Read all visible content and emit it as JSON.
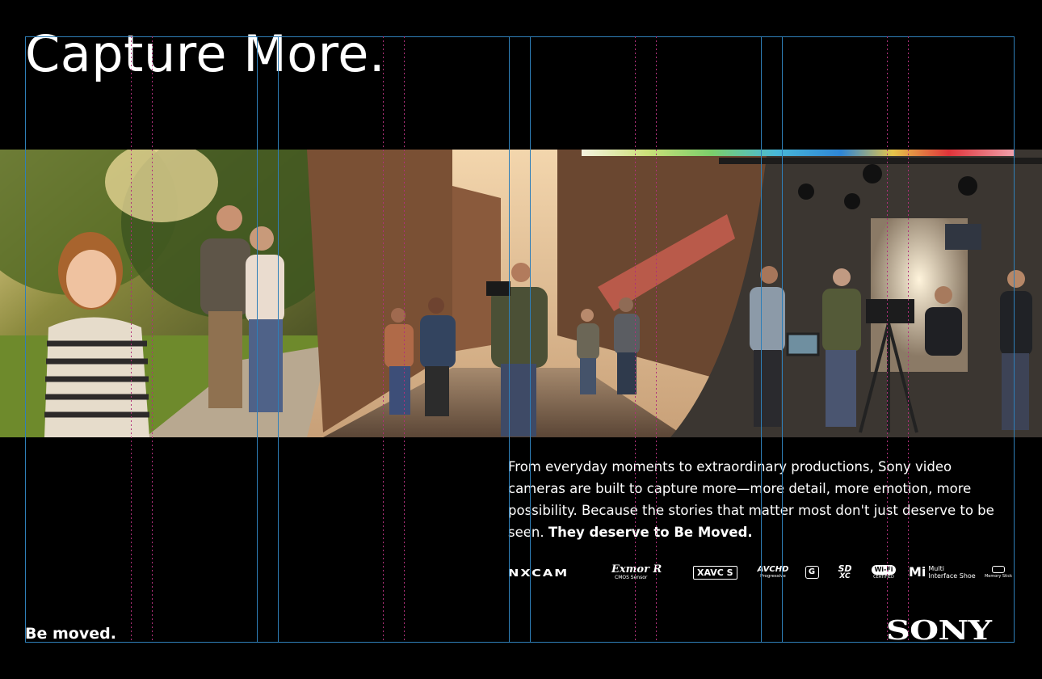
{
  "headline": "Capture More.",
  "body": {
    "text": "From everyday moments to extraordinary productions, Sony video cameras are built to capture more—more detail, more emotion, more possibility. Because the stories that matter most don't just deserve to be seen.",
    "emphasis": "They deserve to Be Moved."
  },
  "logos": {
    "nxcam": "NXCAM",
    "exmor": "Exmor R",
    "exmor_sub": "CMOS Sensor",
    "xavc": "XAVC S",
    "avchd": "AVCHD",
    "avchd_sub": "Progressive",
    "g_lens": "G",
    "sdxc_top": "SD",
    "sdxc_bottom": "XC",
    "wifi": "Wi-Fi",
    "wifi_sub": "CERTIFIED",
    "mi_short": "Mi",
    "mi_line1": "Multi",
    "mi_line2": "Interface Shoe",
    "memory_stick": "Memory Stick"
  },
  "tagline": "Be moved.",
  "brand": "SONY",
  "colors": {
    "background": "#000000",
    "text": "#ffffff",
    "guide_blue": "#2f7fb8",
    "guide_magenta": "#b0307a"
  }
}
